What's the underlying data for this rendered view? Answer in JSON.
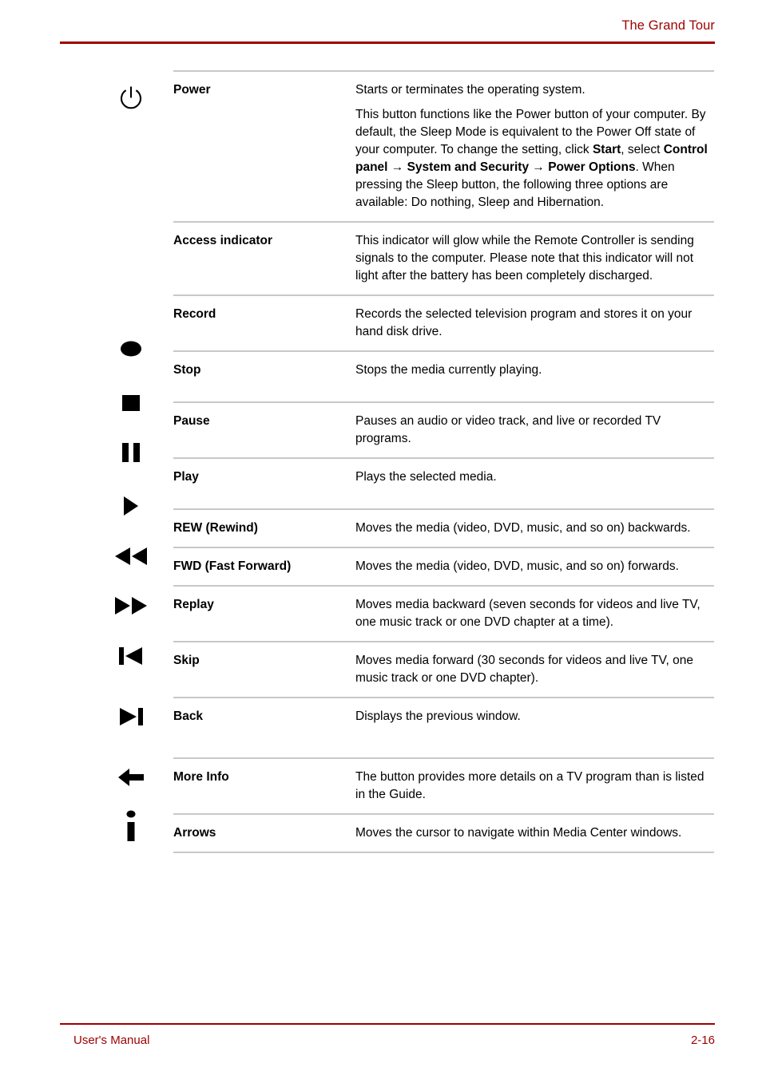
{
  "header": {
    "title": "The Grand Tour",
    "rule_color": "#9d0000"
  },
  "footer": {
    "left_label": "User's Manual",
    "page_number": "2-16",
    "rule_color": "#9d0000"
  },
  "table": {
    "rows": [
      {
        "icon": "power-icon",
        "name": "Power",
        "paragraphs": [
          "Starts or terminates the operating system.",
          "This button functions like the Power button of your computer. By default, the Sleep Mode is equivalent to the Power Off state of your computer. To change the setting, click <b>Start</b>, select <b>Control panel → System and Security → Power Options</b>. When pressing the Sleep button, the following three options are available: Do nothing, Sleep and Hibernation."
        ]
      },
      {
        "icon": "none",
        "name": "Access indicator",
        "paragraphs": [
          "This indicator will glow while the Remote Controller is sending signals to the computer. Please note that this indicator will not light after the battery has been completely discharged."
        ]
      },
      {
        "icon": "record-icon",
        "name": "Record",
        "paragraphs": [
          "Records the selected television program and stores it on your hand disk drive."
        ]
      },
      {
        "icon": "stop-icon",
        "name": "Stop",
        "paragraphs": [
          "Stops the media currently playing."
        ]
      },
      {
        "icon": "pause-icon",
        "name": "Pause",
        "paragraphs": [
          "Pauses an audio or video track, and live or recorded TV programs."
        ]
      },
      {
        "icon": "play-icon",
        "name": "Play",
        "paragraphs": [
          "Plays the selected media."
        ]
      },
      {
        "icon": "rewind-icon",
        "name": "REW (Rewind)",
        "paragraphs": [
          "Moves the media (video, DVD, music, and so on) backwards."
        ]
      },
      {
        "icon": "fast-forward-icon",
        "name": "FWD (Fast Forward)",
        "paragraphs": [
          "Moves the media (video, DVD, music, and so on) forwards."
        ]
      },
      {
        "icon": "replay-icon",
        "name": "Replay",
        "paragraphs": [
          "Moves media backward (seven seconds for videos and live TV, one music track or one DVD chapter at a time)."
        ]
      },
      {
        "icon": "skip-icon",
        "name": "Skip",
        "paragraphs": [
          "Moves media forward (30 seconds for videos and live TV, one music track or one DVD chapter)."
        ]
      },
      {
        "icon": "back-arrow-icon",
        "name": "Back",
        "paragraphs": [
          "Displays the previous window."
        ]
      },
      {
        "icon": "more-info-icon",
        "name": "More Info",
        "paragraphs": [
          "The button provides more details on a TV program than is listed in the Guide."
        ]
      },
      {
        "icon": "none",
        "name": "Arrows",
        "paragraphs": [
          "Moves the cursor to navigate within Media Center windows."
        ]
      }
    ]
  }
}
